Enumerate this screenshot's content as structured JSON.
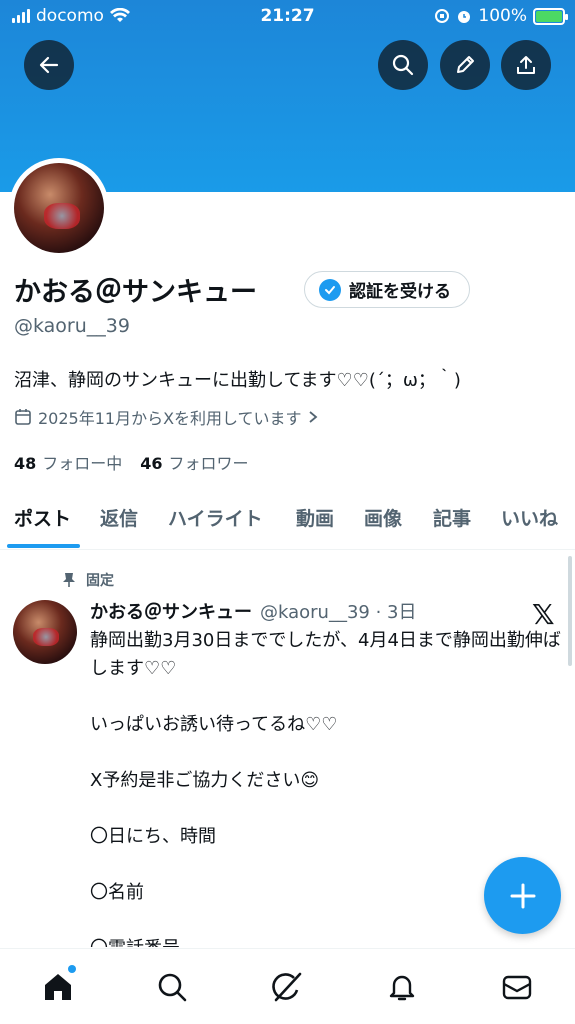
{
  "status_bar": {
    "carrier": "docomo",
    "time": "21:27",
    "battery": "100%"
  },
  "header": {
    "back": "back-arrow-icon",
    "actions": [
      "search-icon",
      "edit-pencil-icon",
      "share-icon"
    ]
  },
  "profile": {
    "display_name": "かおる＠サンキュー",
    "verify_label": "認証を受ける",
    "handle": "@kaoru__39",
    "bio": "沼津、静岡のサンキューに出勤してます♡♡(´；ω；｀)",
    "joined": "2025年11月からXを利用しています",
    "following_count": "48",
    "following_label": "フォロー中",
    "followers_count": "46",
    "followers_label": "フォロワー"
  },
  "tabs": [
    {
      "label": "ポスト",
      "active": true
    },
    {
      "label": "返信"
    },
    {
      "label": "ハイライト"
    },
    {
      "label": "動画"
    },
    {
      "label": "画像"
    },
    {
      "label": "記事"
    },
    {
      "label": "いいね"
    }
  ],
  "post": {
    "pinned_label": "固定",
    "author": "かおる＠サンキュー",
    "handle_time": "@kaoru__39 · 3日",
    "lines": [
      "静岡出勤3月30日まででしたが、4月4日まで静岡出勤伸ばします♡♡",
      "",
      "いっぱいお誘い待ってるね♡♡",
      "",
      "X予約是非ご協力ください😊",
      "",
      "〇日にち、時間",
      "",
      "〇名前",
      "",
      "〇電話番号"
    ]
  },
  "bottom_nav": [
    "home-icon",
    "search-icon",
    "grok-icon",
    "notifications-icon",
    "messages-icon"
  ],
  "colors": {
    "accent": "#1d9bf0",
    "banner": "#1a8fe0",
    "text": "#0f1419",
    "muted": "#536471"
  }
}
